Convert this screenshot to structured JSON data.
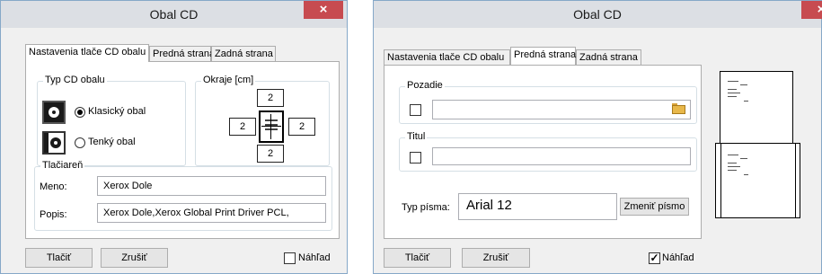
{
  "colors": {
    "accent": "#c74b50",
    "border": "#86a8c8",
    "background": "#f0f0f0"
  },
  "left": {
    "title": "Obal CD",
    "tabs": [
      "Nastavenia tlače CD obalu",
      "Predná strana",
      "Zadná strana"
    ],
    "cd_type": {
      "label": "Typ CD obalu",
      "options": [
        {
          "label": "Klasický obal",
          "selected": true
        },
        {
          "label": "Tenký obal",
          "selected": false
        }
      ]
    },
    "margins": {
      "label": "Okraje [cm]",
      "top": "2",
      "left": "2",
      "right": "2",
      "bottom": "2"
    },
    "printer": {
      "label": "Tlačiareň",
      "name_label": "Meno:",
      "name_value": "Xerox Dole",
      "desc_label": "Popis:",
      "desc_value": "Xerox Dole,Xerox Global Print Driver PCL,"
    },
    "buttons": {
      "print": "Tlačiť",
      "cancel": "Zrušiť"
    },
    "preview": {
      "label": "Náhľad",
      "checked": false
    }
  },
  "right": {
    "title": "Obal CD",
    "tabs": [
      "Nastavenia tlače CD obalu",
      "Predná strana",
      "Zadná strana"
    ],
    "background": {
      "label": "Pozadie",
      "checked": false,
      "value": ""
    },
    "title_group": {
      "label": "Titul",
      "checked": false,
      "value": ""
    },
    "font": {
      "label": "Typ písma:",
      "value": "Arial 12",
      "change_button": "Zmeniť písmo"
    },
    "buttons": {
      "print": "Tlačiť",
      "cancel": "Zrušiť"
    },
    "preview": {
      "label": "Náhľad",
      "checked": true
    }
  }
}
